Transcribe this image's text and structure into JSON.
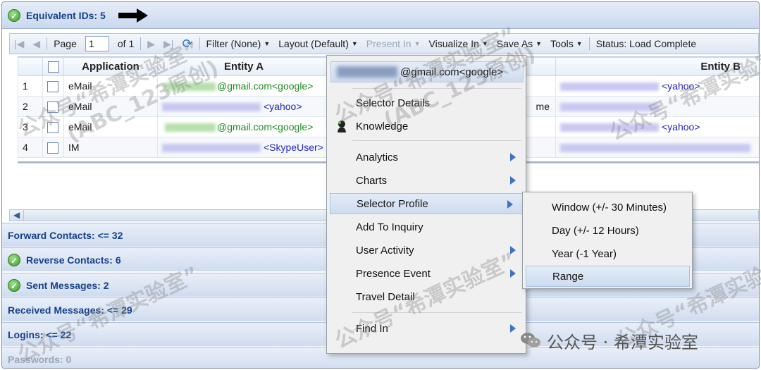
{
  "panels": {
    "equivalent_ids": "Equivalent IDs: 5",
    "forward_contacts": "Forward Contacts: <= 32",
    "reverse_contacts": "Reverse Contacts: 6",
    "sent_messages": "Sent Messages: 2",
    "received_messages": "Received Messages: <= 29",
    "logins": "Logins: <= 22",
    "passwords": "Passwords: 0"
  },
  "toolbar": {
    "page_label": "Page",
    "page_value": "1",
    "of_label": "of 1",
    "filter": "Filter (None)",
    "layout": "Layout (Default)",
    "present_in": "Present In",
    "visualize_in": "Visualize In",
    "save_as": "Save As",
    "tools": "Tools",
    "status": "Status: Load Complete"
  },
  "grid": {
    "columns": [
      "Application",
      "Entity A",
      "Entity B"
    ],
    "rows": [
      {
        "num": "1",
        "app": "eMail",
        "entity_a": "@gmail.com<google>",
        "entity_b": "<yahoo>"
      },
      {
        "num": "2",
        "app": "eMail",
        "entity_a": "<yahoo>",
        "entity_b": ""
      },
      {
        "num": "3",
        "app": "eMail",
        "entity_a": "@gmail.com<google>",
        "entity_b": "<yahoo>"
      },
      {
        "num": "4",
        "app": "IM",
        "entity_a": "<SkypeUser>",
        "entity_b": ""
      }
    ],
    "row2_partial": "me"
  },
  "context_menu": {
    "header": "@gmail.com<google>",
    "items": [
      "Selector Details",
      "Knowledge",
      "Analytics",
      "Charts",
      "Selector Profile",
      "Add To Inquiry",
      "User Activity",
      "Presence Event",
      "Travel Detail",
      "Find In"
    ]
  },
  "submenu": {
    "items": [
      "Window (+/- 30 Minutes)",
      "Day (+/- 12 Hours)",
      "Year (-1 Year)",
      "Range"
    ]
  },
  "watermarks": {
    "line1": "公众号“希潭实验室”",
    "line2": "(ABC_123原创)"
  },
  "brand": "公众号 · 希潭实验室",
  "icons": {
    "check": "check-circle-icon",
    "arrow": "arrow-right-icon",
    "refresh": "refresh-icon",
    "person": "person-icon",
    "wechat": "wechat-icon"
  }
}
